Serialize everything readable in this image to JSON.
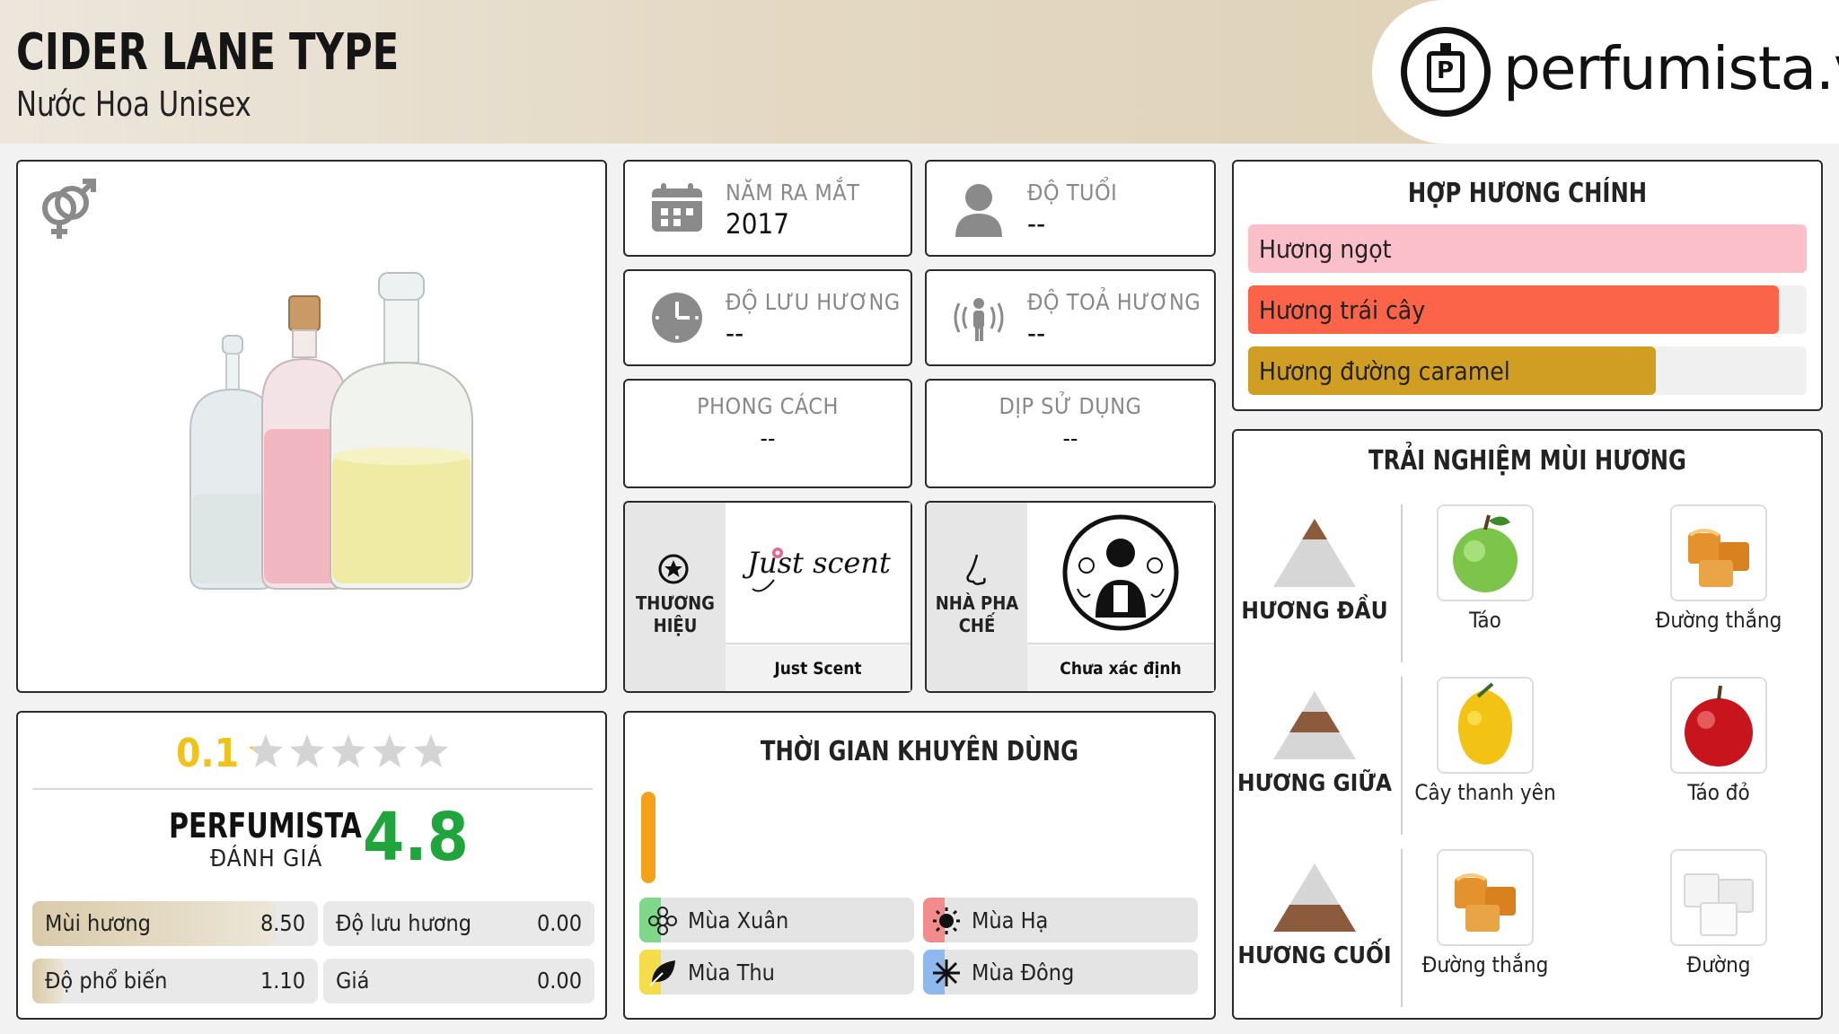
{
  "header": {
    "title": "CIDER LANE TYPE",
    "subtitle": "Nước Hoa Unisex",
    "logo_text": "perfumista.vn"
  },
  "info": {
    "launch": {
      "label": "NĂM RA MẮT",
      "value": "2017"
    },
    "age": {
      "label": "ĐỘ TUỔI",
      "value": "--"
    },
    "longevity": {
      "label": "ĐỘ LƯU HƯƠNG",
      "value": "--"
    },
    "sillage": {
      "label": "ĐỘ TOẢ HƯƠNG",
      "value": "--"
    },
    "style": {
      "label": "PHONG CÁCH",
      "value": "--"
    },
    "occasion": {
      "label": "DỊP SỬ DỤNG",
      "value": "--"
    }
  },
  "brand": {
    "label": "THƯƠNG HIỆU",
    "name": "Just Scent",
    "logo_text": "Just scent"
  },
  "perfumer": {
    "label": "NHÀ PHA CHẾ",
    "name": "Chưa xác định"
  },
  "rating": {
    "user_score": "0.1",
    "stars_filled": 0.02,
    "perfumista_label": "PERFUMISTA",
    "perfumista_sub": "ĐÁNH GIÁ",
    "perfumista_score": "4.8",
    "metrics": [
      {
        "label": "Mùi hương",
        "value": "8.50",
        "fill": 0.85
      },
      {
        "label": "Độ lưu hương",
        "value": "0.00",
        "fill": 0
      },
      {
        "label": "Độ phổ biến",
        "value": "1.10",
        "fill": 0.11
      },
      {
        "label": "Giá",
        "value": "0.00",
        "fill": 0
      }
    ]
  },
  "seasons": {
    "title": "THỜI GIAN KHUYÊN DÙNG",
    "items": [
      {
        "label": "Mùa Xuân",
        "color": "#7fd88a",
        "icon": "flower-icon"
      },
      {
        "label": "Mùa Hạ",
        "color": "#f28b8b",
        "icon": "sun-icon"
      },
      {
        "label": "Mùa Thu",
        "color": "#f4dc4a",
        "icon": "leaf-icon"
      },
      {
        "label": "Mùa Đông",
        "color": "#8fb8ec",
        "icon": "snowflake-icon"
      }
    ]
  },
  "accords": {
    "title": "HỢP HƯƠNG CHÍNH",
    "items": [
      {
        "label": "Hương ngọt",
        "color": "#fbbfc9",
        "fill": 1.0
      },
      {
        "label": "Hương trái cây",
        "color": "#fb6449",
        "fill": 0.95
      },
      {
        "label": "Hương đường caramel",
        "color": "#d19e24",
        "fill": 0.73
      }
    ]
  },
  "notes": {
    "title": "TRẢI NGHIỆM MÙI HƯƠNG",
    "top": {
      "label": "HƯƠNG ĐẦU",
      "items": [
        "Táo",
        "Đường thắng"
      ]
    },
    "middle": {
      "label": "HƯƠNG GIỮA",
      "items": [
        "Cây thanh yên",
        "Táo đỏ"
      ]
    },
    "base": {
      "label": "HƯƠNG CUỐI",
      "items": [
        "Đường thắng",
        "Đường"
      ]
    }
  }
}
